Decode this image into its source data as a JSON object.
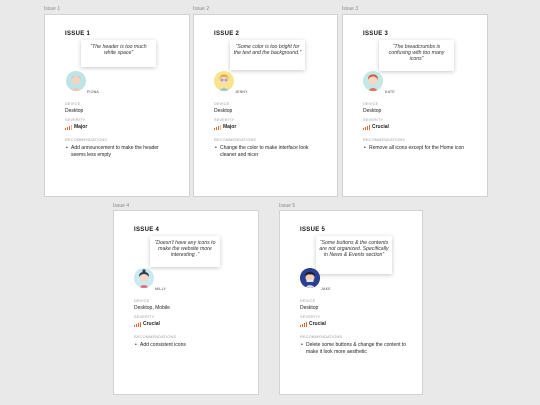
{
  "frames": [
    {
      "frame_label": "Issue 1",
      "title": "ISSUE 1",
      "quote": "“The header is too much white space”",
      "persona": "FIONA",
      "device_label": "DEVICE",
      "device": "Desktop",
      "severity_label": "SEVERITY",
      "severity": "Major",
      "severity_level": 3,
      "rec_label": "RECOMMENDATIONS",
      "recommendation": "Add announcement to make the header seems less empty"
    },
    {
      "frame_label": "Issue 2",
      "title": "ISSUE 2",
      "quote": "“Some color is too bright for the text and the background.”",
      "persona": "JENNY",
      "device_label": "DEVICE",
      "device": "Desktop",
      "severity_label": "SEVERITY",
      "severity": "Major",
      "severity_level": 3,
      "rec_label": "RECOMMENDATIONS",
      "recommendation": "Change the color to make interface look cleaner and nicer"
    },
    {
      "frame_label": "Issue 3",
      "title": "ISSUE 3",
      "quote": "“The breadcrumbs is confusing with too many icons”",
      "persona": "KATE",
      "device_label": "DEVICE",
      "device": "Desktop",
      "severity_label": "SEVERITY",
      "severity": "Crucial",
      "severity_level": 4,
      "rec_label": "RECOMMENDATIONS",
      "recommendation": "Remove all icons except for the Home icon"
    },
    {
      "frame_label": "Issue 4",
      "title": "ISSUE 4",
      "quote": "“Doesn't have any icons to make the website more interesting .”",
      "persona": "MILLY",
      "device_label": "DEVICE",
      "device": "Desktop, Mobile",
      "severity_label": "SEVERITY",
      "severity": "Crucial",
      "severity_level": 4,
      "rec_label": "RECOMMENDATIONS",
      "recommendation": "Add consistent icons"
    },
    {
      "frame_label": "Issue 5",
      "title": "ISSUE 5",
      "quote": "“Some buttons & the contents are not organized. Specifically in News & Events section”",
      "persona": "JAKE",
      "device_label": "DEVICE",
      "device": "Desktop",
      "severity_label": "SEVERITY",
      "severity": "Crucial",
      "severity_level": 4,
      "rec_label": "RECOMMENDATIONS",
      "recommendation": "Delete some buttons & change the content to make it look more aesthetic"
    }
  ],
  "colors": {
    "severity_bar": "#e8632b",
    "canvas": "#e9e9e9"
  }
}
